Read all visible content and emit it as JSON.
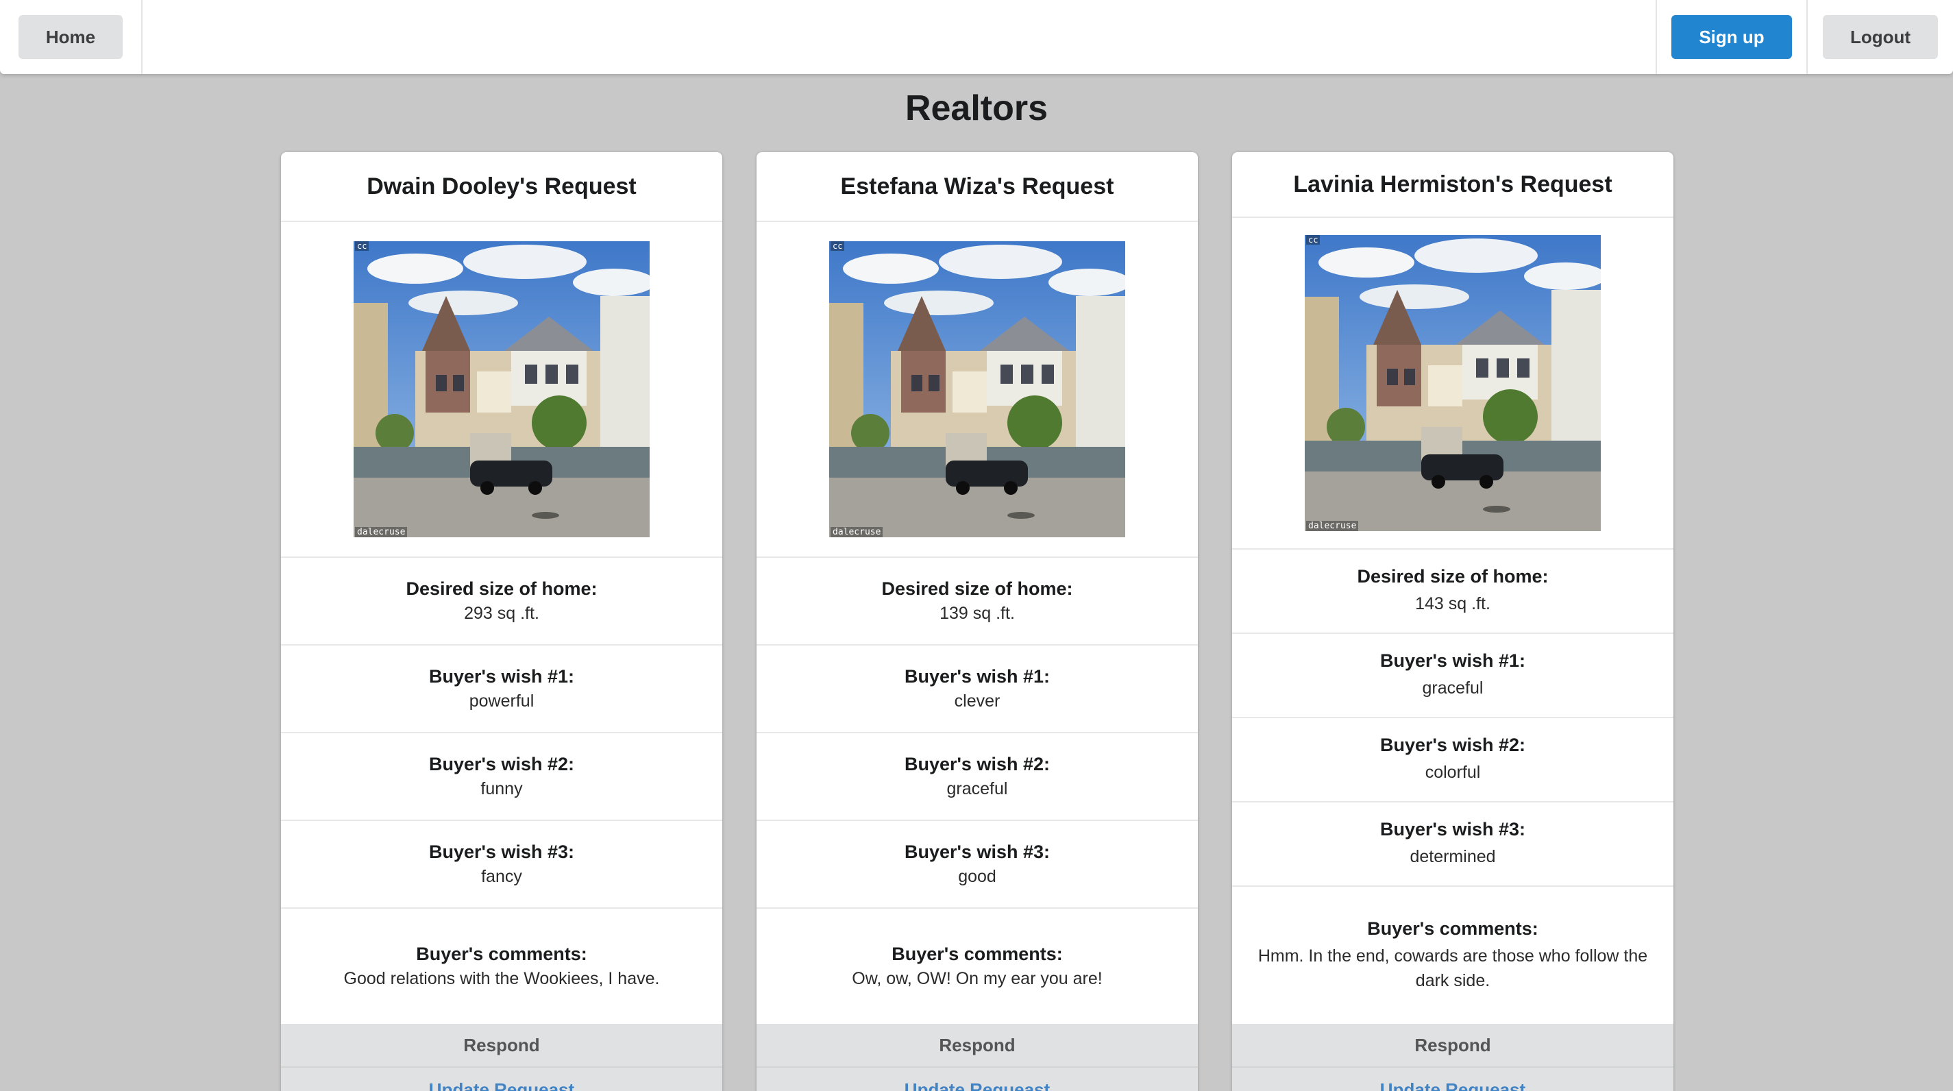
{
  "nav": {
    "home_label": "Home",
    "signup_label": "Sign up",
    "logout_label": "Logout"
  },
  "page": {
    "title": "Realtors"
  },
  "labels": {
    "size": "Desired size of home:",
    "wish1": "Buyer's wish #1:",
    "wish2": "Buyer's wish #2:",
    "wish3": "Buyer's wish #3:",
    "comments": "Buyer's comments:",
    "respond": "Respond",
    "update": "Update Requeast",
    "image_cc": "cc",
    "image_credit": "dalecruse"
  },
  "colors": {
    "primary": "#2185d0",
    "link": "#4183c4",
    "background": "#c8c8c8"
  },
  "cards": [
    {
      "title": "Dwain Dooley's Request",
      "size": "293 sq .ft.",
      "wish1": "powerful",
      "wish2": "funny",
      "wish3": "fancy",
      "comments": "Good relations with the Wookiees, I have."
    },
    {
      "title": "Estefana Wiza's Request",
      "size": "139 sq .ft.",
      "wish1": "clever",
      "wish2": "graceful",
      "wish3": "good",
      "comments": "Ow, ow, OW! On my ear you are!"
    },
    {
      "title": "Lavinia Hermiston's Request",
      "size": "143 sq .ft.",
      "wish1": "graceful",
      "wish2": "colorful",
      "wish3": "determined",
      "comments": "Hmm. In the end, cowards are those who follow the dark side."
    }
  ]
}
